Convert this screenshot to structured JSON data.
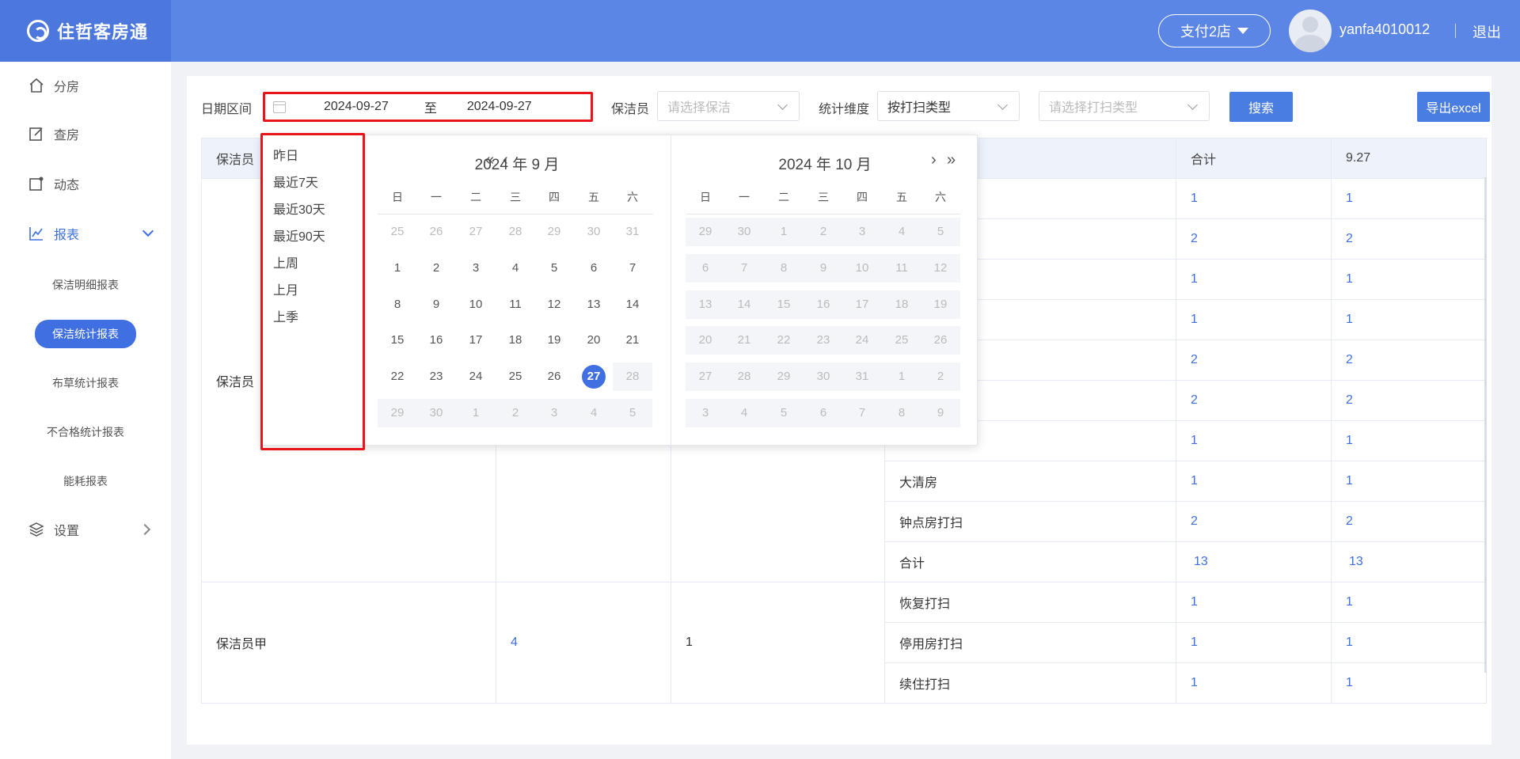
{
  "header": {
    "brand": "住哲客房通",
    "store": "支付2店",
    "username": "yanfa4010012",
    "logout": "退出"
  },
  "sidebar": {
    "items": [
      {
        "label": "分房",
        "icon": "home-icon"
      },
      {
        "label": "查房",
        "icon": "edit-icon"
      },
      {
        "label": "动态",
        "icon": "activity-icon"
      },
      {
        "label": "报表",
        "icon": "chart-icon"
      },
      {
        "label": "设置",
        "icon": "layers-icon"
      }
    ],
    "sub_items": [
      "保洁明细报表",
      "保洁统计报表",
      "布草统计报表",
      "不合格统计报表",
      "能耗报表"
    ]
  },
  "filters": {
    "date_label": "日期区间",
    "start_date": "2024-09-27",
    "to": "至",
    "end_date": "2024-09-27",
    "cleaner_label": "保洁员",
    "cleaner_placeholder": "请选择保洁",
    "dimension_label": "统计维度",
    "dimension_value": "按打扫类型",
    "type_placeholder": "请选择打扫类型",
    "search": "搜索",
    "export": "导出excel"
  },
  "picker": {
    "shortcuts": [
      "昨日",
      "最近7天",
      "最近30天",
      "最近90天",
      "上周",
      "上月",
      "上季"
    ],
    "left_title": "2024 年 9 月",
    "right_title": "2024 年 10 月",
    "weekdays": [
      "日",
      "一",
      "二",
      "三",
      "四",
      "五",
      "六"
    ],
    "nav_prev_year": "«",
    "nav_prev_month": "‹",
    "nav_next_month": "›",
    "nav_next_year": "»",
    "left_days": [
      [
        "25",
        "26",
        "27",
        "28",
        "29",
        "30",
        "31"
      ],
      [
        "1",
        "2",
        "3",
        "4",
        "5",
        "6",
        "7"
      ],
      [
        "8",
        "9",
        "10",
        "11",
        "12",
        "13",
        "14"
      ],
      [
        "15",
        "16",
        "17",
        "18",
        "19",
        "20",
        "21"
      ],
      [
        "22",
        "23",
        "24",
        "25",
        "26",
        "27",
        "28"
      ],
      [
        "29",
        "30",
        "1",
        "2",
        "3",
        "4",
        "5"
      ]
    ],
    "right_days": [
      [
        "29",
        "30",
        "1",
        "2",
        "3",
        "4",
        "5"
      ],
      [
        "6",
        "7",
        "8",
        "9",
        "10",
        "11",
        "12"
      ],
      [
        "13",
        "14",
        "15",
        "16",
        "17",
        "18",
        "19"
      ],
      [
        "20",
        "21",
        "22",
        "23",
        "24",
        "25",
        "26"
      ],
      [
        "27",
        "28",
        "29",
        "30",
        "31",
        "1",
        "2"
      ],
      [
        "3",
        "4",
        "5",
        "6",
        "7",
        "8",
        "9"
      ]
    ]
  },
  "table": {
    "col0": "保洁员",
    "col_total": "合计",
    "col_date": "9.27",
    "group1_name": "保洁员",
    "rows": [
      {
        "type": "",
        "total": "1",
        "day": "1"
      },
      {
        "type": "",
        "total": "2",
        "day": "2"
      },
      {
        "type": "",
        "total": "1",
        "day": "1"
      },
      {
        "type": "",
        "total": "1",
        "day": "1"
      },
      {
        "type": "",
        "total": "2",
        "day": "2"
      },
      {
        "type": "",
        "total": "2",
        "day": "2"
      },
      {
        "type": "",
        "total": "1",
        "day": "1"
      },
      {
        "type": "大清房",
        "total": "1",
        "day": "1"
      },
      {
        "type": "钟点房打扫",
        "total": "2",
        "day": "2"
      },
      {
        "type": "合计",
        "total": "13",
        "day": "13"
      }
    ],
    "group2_name": "保洁员甲",
    "group2_rooms": "4",
    "group2_count": "1",
    "rows2": [
      {
        "type": "恢复打扫",
        "total": "1",
        "day": "1"
      },
      {
        "type": "停用房打扫",
        "total": "1",
        "day": "1"
      },
      {
        "type": "续住打扫",
        "total": "1",
        "day": "1"
      }
    ]
  },
  "colors": {
    "accent": "#3f6fe0",
    "highlight": "#e8141a"
  }
}
